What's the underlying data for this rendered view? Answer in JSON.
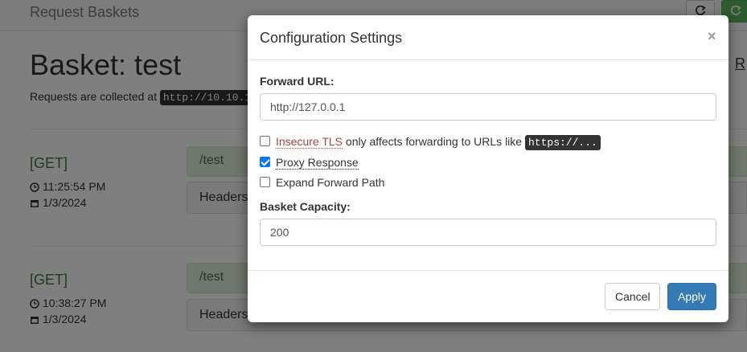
{
  "app": {
    "brand": "Request Baskets"
  },
  "basket": {
    "title": "Basket: test",
    "collected_text": "Requests are collected at",
    "collected_url": "http://10.10.1",
    "right_link": "R"
  },
  "requests": [
    {
      "method": "[GET]",
      "time": "11:25:54 PM",
      "date": "1/3/2024",
      "path": "/test",
      "headers_label": "Headers"
    },
    {
      "method": "[GET]",
      "time": "10:38:27 PM",
      "date": "1/3/2024",
      "path": "/test",
      "headers_label": "Headers"
    }
  ],
  "modal": {
    "title": "Configuration Settings",
    "close": "×",
    "forward_url_label": "Forward URL:",
    "forward_url_value": "http://127.0.0.1",
    "insecure_tls_label": "Insecure TLS",
    "insecure_tls_suffix": "only affects forwarding to URLs like",
    "insecure_tls_code": "https://...",
    "insecure_tls_checked": false,
    "proxy_response_label": "Proxy Response",
    "proxy_response_checked": true,
    "expand_forward_path_label": "Expand Forward Path",
    "expand_forward_path_checked": false,
    "basket_capacity_label": "Basket Capacity:",
    "basket_capacity_value": "200",
    "cancel_label": "Cancel",
    "apply_label": "Apply"
  },
  "icons": {
    "refresh": "refresh-icon",
    "clock": "clock-icon",
    "calendar": "calendar-icon"
  },
  "colors": {
    "primary": "#337ab7",
    "success_text": "#3c763d",
    "success_bg": "#dff0d8",
    "danger_text": "#a94442"
  }
}
